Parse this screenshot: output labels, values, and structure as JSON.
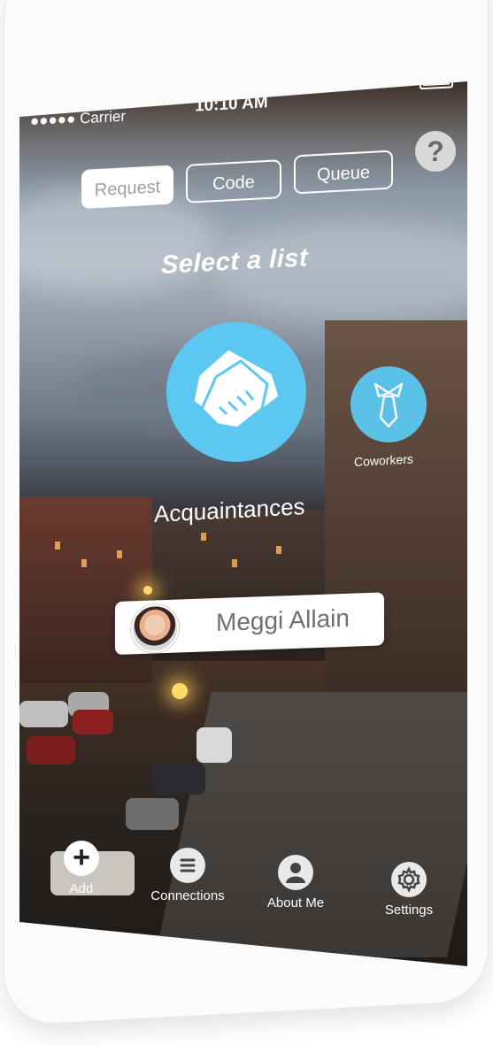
{
  "status_bar": {
    "carrier": "●●●●● Carrier",
    "time": "10:10 AM"
  },
  "help": {
    "label": "?"
  },
  "tabs": [
    {
      "label": "Request",
      "active": true
    },
    {
      "label": "Code",
      "active": false
    },
    {
      "label": "Queue",
      "active": false
    }
  ],
  "heading": "Select a list",
  "lists": {
    "main": {
      "label": "Acquaintances",
      "icon": "handshake-icon"
    },
    "side": {
      "label": "Coworkers",
      "icon": "necktie-icon"
    }
  },
  "person": {
    "name": "Meggi Allain"
  },
  "tabbar": {
    "items": [
      {
        "label": "Add",
        "icon": "plus-icon"
      },
      {
        "label": "Connections",
        "icon": "menu-icon"
      },
      {
        "label": "About Me",
        "icon": "user-icon"
      },
      {
        "label": "Settings",
        "icon": "gear-icon"
      }
    ]
  },
  "colors": {
    "accent": "#5cc8f1"
  }
}
